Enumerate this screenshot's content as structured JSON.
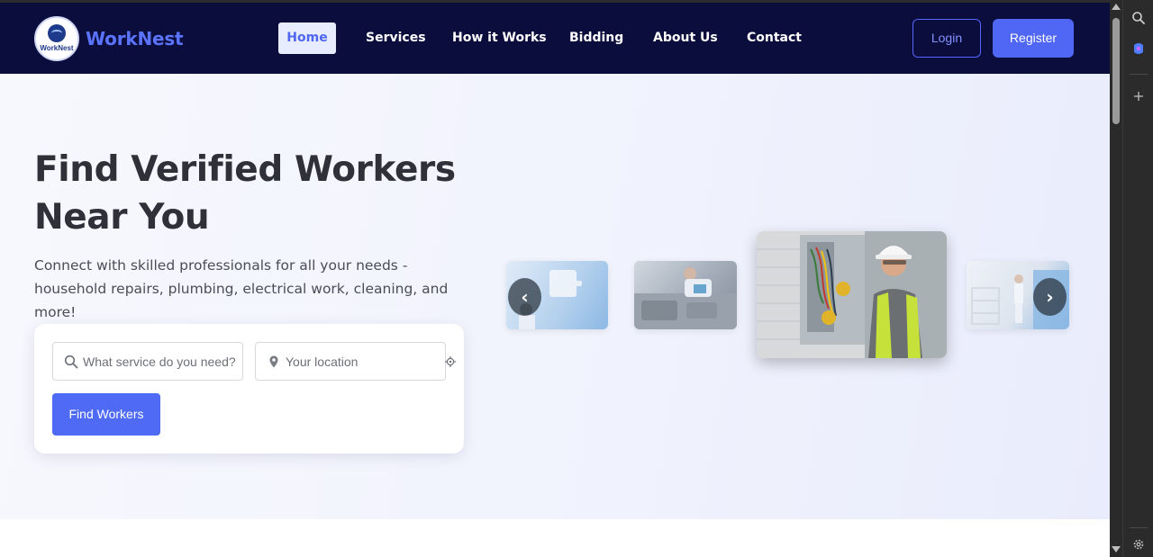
{
  "navbar": {
    "logo_text": "WorkNest",
    "brand": "WorkNest",
    "links": [
      "Home",
      "Services",
      "How it Works",
      "Bidding",
      "About Us",
      "Contact"
    ],
    "login_label": "Login",
    "register_label": "Register"
  },
  "hero": {
    "title": "Find Verified Workers Near You",
    "subtitle": "Connect with skilled professionals for all your needs - household repairs, plumbing, electrical work, cleaning, and more!",
    "search": {
      "service_placeholder": "What service do you need?",
      "location_placeholder": "Your location",
      "find_button": "Find Workers"
    },
    "carousel": {
      "prev": "‹",
      "next": "›"
    }
  },
  "colors": {
    "navbar_bg": "#0b0d3d",
    "accent": "#5066f5",
    "brand_text": "#5b74ff"
  }
}
